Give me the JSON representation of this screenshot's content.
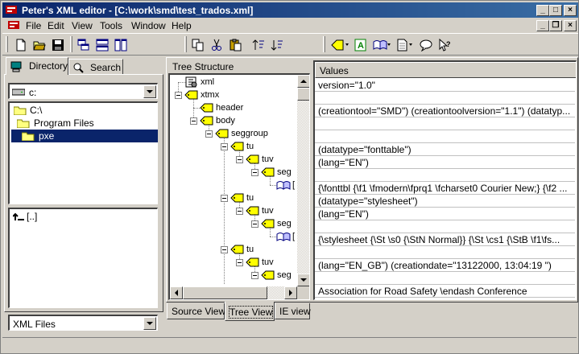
{
  "window": {
    "title": "Peter's XML editor - [C:\\work\\smd\\test_trados.xml]",
    "min_glyph": "_",
    "max_glyph": "□",
    "close_glyph": "×"
  },
  "menu": [
    "File",
    "Edit",
    "View",
    "Tools",
    "Window",
    "Help"
  ],
  "mdi": {
    "min": "_",
    "restore": "❐",
    "close": "×"
  },
  "left": {
    "tabs": [
      "Directory",
      "Search"
    ],
    "drive": "c:",
    "folders": [
      "C:\\",
      "Program Files",
      "pxe"
    ],
    "selected_folder": "pxe",
    "files": [
      "[..]"
    ],
    "filter": "XML Files"
  },
  "tree": {
    "header": "Tree Structure",
    "nodes": [
      {
        "label": "xml",
        "kind": "pi"
      },
      {
        "label": "xtmx",
        "kind": "element"
      },
      {
        "label": "header",
        "kind": "element"
      },
      {
        "label": "body",
        "kind": "element"
      },
      {
        "label": "seggroup",
        "kind": "element"
      },
      {
        "label": "tu",
        "kind": "element"
      },
      {
        "label": "tuv",
        "kind": "element"
      },
      {
        "label": "seg",
        "kind": "element"
      },
      {
        "label": "[",
        "kind": "text"
      },
      {
        "label": "tu",
        "kind": "element"
      },
      {
        "label": "tuv",
        "kind": "element"
      },
      {
        "label": "seg",
        "kind": "element"
      },
      {
        "label": "[",
        "kind": "text"
      },
      {
        "label": "tu",
        "kind": "element"
      },
      {
        "label": "tuv",
        "kind": "element"
      },
      {
        "label": "seg",
        "kind": "element"
      }
    ]
  },
  "values": {
    "header": "Values",
    "rows": [
      "version=\"1.0\"",
      "",
      "(creationtool=\"SMD\") (creationtoolversion=\"1.1\") (datatyp...",
      "",
      "",
      "(datatype=\"fonttable\")",
      "(lang=\"EN\")",
      "",
      "{\\fonttbl {\\f1 \\fmodern\\fprq1 \\fcharset0 Courier New;} {\\f2 ...",
      "(datatype=\"stylesheet\")",
      "(lang=\"EN\")",
      "",
      "{\\stylesheet {\\St \\s0 {\\StN Normal}} {\\St \\cs1 {\\StB \\f1\\fs...",
      "",
      "(lang=\"EN_GB\") (creationdate=\"13122000, 13:04:19 \")",
      "",
      "Association for Road Safety \\endash Conference"
    ]
  },
  "view_tabs": [
    "Source View",
    "Tree View",
    "IE view"
  ],
  "active_view": "Tree View",
  "colors": {
    "title_start": "#0a246a",
    "title_end": "#3a6ea5",
    "selection": "#0a246a",
    "face": "#d4d0c8"
  }
}
